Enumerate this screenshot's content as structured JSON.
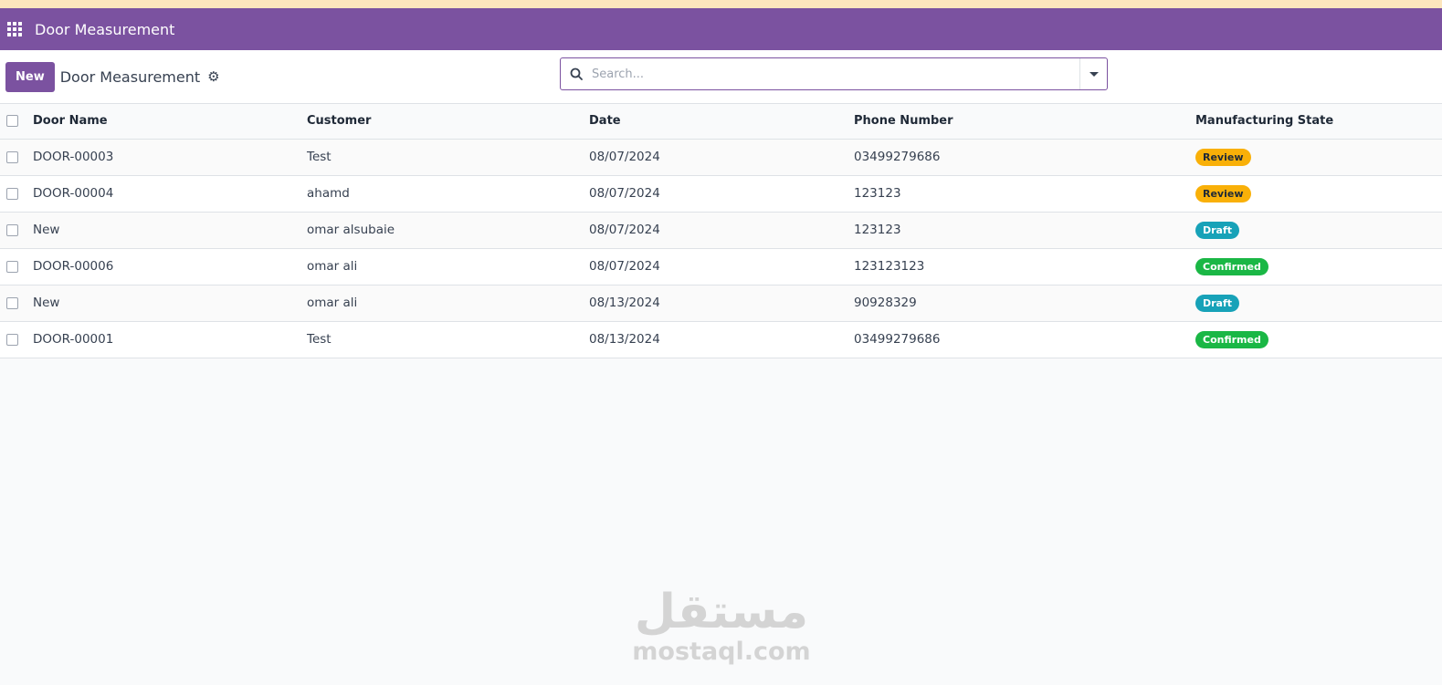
{
  "navbar": {
    "app_title": "Door Measurement",
    "apps_icon": "apps-grid-icon"
  },
  "control_panel": {
    "new_label": "New",
    "title": "Door Measurement",
    "gear_icon": "gear-icon",
    "search": {
      "placeholder": "Search...",
      "value": ""
    }
  },
  "table": {
    "headers": [
      "Door Name",
      "Customer",
      "Date",
      "Phone Number",
      "Manufacturing State"
    ],
    "rows": [
      {
        "door_name": "DOOR-00003",
        "customer": "Test",
        "date": "08/07/2024",
        "phone": "03499279686",
        "state": "Review"
      },
      {
        "door_name": "DOOR-00004",
        "customer": "ahamd",
        "date": "08/07/2024",
        "phone": "123123",
        "state": "Review"
      },
      {
        "door_name": "New",
        "customer": "omar alsubaie",
        "date": "08/07/2024",
        "phone": "123123",
        "state": "Draft"
      },
      {
        "door_name": "DOOR-00006",
        "customer": "omar ali",
        "date": "08/07/2024",
        "phone": "123123123",
        "state": "Confirmed"
      },
      {
        "door_name": "New",
        "customer": "omar ali",
        "date": "08/13/2024",
        "phone": "90928329",
        "state": "Draft"
      },
      {
        "door_name": "DOOR-00001",
        "customer": "Test",
        "date": "08/13/2024",
        "phone": "03499279686",
        "state": "Confirmed"
      }
    ]
  },
  "watermark": {
    "arabic": "مستقل",
    "latin": "mostaql.com"
  },
  "colors": {
    "brand": "#7b52a0",
    "review": "#f9b008",
    "draft": "#17a2b8",
    "confirmed": "#1ab745"
  }
}
